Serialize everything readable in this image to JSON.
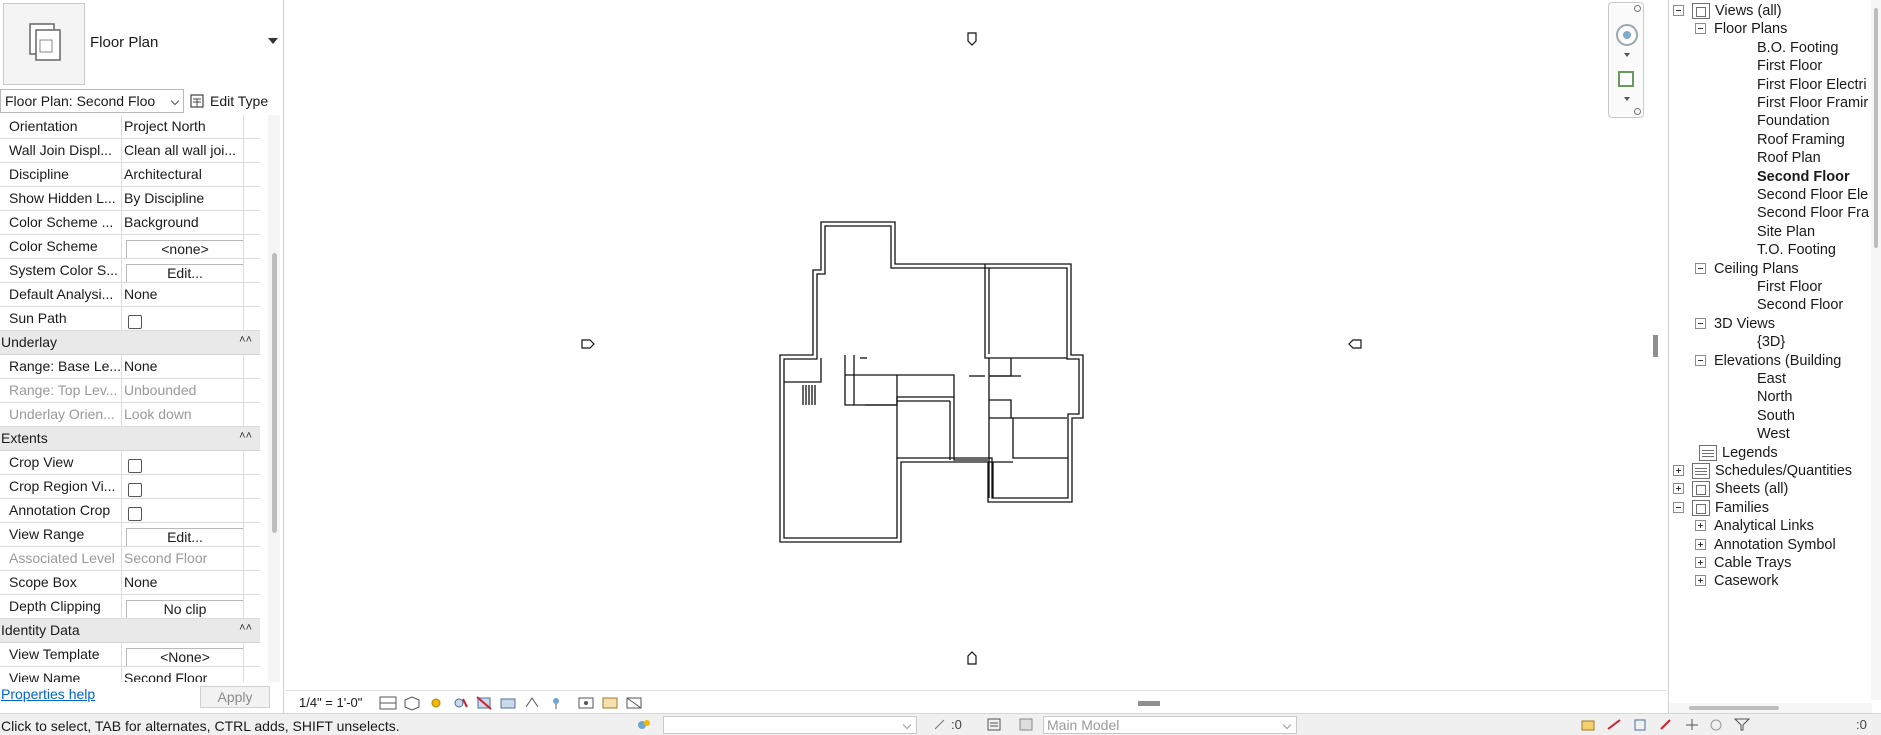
{
  "properties": {
    "type_name": "Floor Plan",
    "instance_selector": "Floor Plan: Second Floo",
    "edit_type_label": "Edit Type",
    "rows_top": [
      {
        "name": "Orientation",
        "value": "Project North",
        "kind": "text"
      },
      {
        "name": "Wall Join Displ...",
        "value": "Clean all wall joi...",
        "kind": "text"
      },
      {
        "name": "Discipline",
        "value": "Architectural",
        "kind": "text"
      },
      {
        "name": "Show Hidden L...",
        "value": "By Discipline",
        "kind": "text"
      },
      {
        "name": "Color Scheme ...",
        "value": "Background",
        "kind": "text"
      },
      {
        "name": "Color Scheme",
        "value": "<none>",
        "kind": "button"
      },
      {
        "name": "System Color S...",
        "value": "Edit...",
        "kind": "button"
      },
      {
        "name": "Default Analysi...",
        "value": "None",
        "kind": "text"
      },
      {
        "name": "Sun Path",
        "value": "",
        "kind": "checkbox"
      }
    ],
    "group_underlay": "Underlay",
    "rows_underlay": [
      {
        "name": "Range: Base Le...",
        "value": "None",
        "kind": "text"
      },
      {
        "name": "Range: Top Lev...",
        "value": "Unbounded",
        "kind": "text",
        "dim": true
      },
      {
        "name": "Underlay Orien...",
        "value": "Look down",
        "kind": "text",
        "dim": true
      }
    ],
    "group_extents": "Extents",
    "rows_extents": [
      {
        "name": "Crop View",
        "value": "",
        "kind": "checkbox"
      },
      {
        "name": "Crop Region Vi...",
        "value": "",
        "kind": "checkbox"
      },
      {
        "name": "Annotation Crop",
        "value": "",
        "kind": "checkbox"
      },
      {
        "name": "View Range",
        "value": "Edit...",
        "kind": "button"
      },
      {
        "name": "Associated Level",
        "value": "Second Floor",
        "kind": "text",
        "dim": true
      },
      {
        "name": "Scope Box",
        "value": "None",
        "kind": "text"
      },
      {
        "name": "Depth Clipping",
        "value": "No clip",
        "kind": "button"
      }
    ],
    "group_identity": "Identity Data",
    "rows_identity": [
      {
        "name": "View Template",
        "value": "<None>",
        "kind": "button"
      },
      {
        "name": "View Name",
        "value": "Second Floor",
        "kind": "text"
      }
    ],
    "help_link": "Properties help",
    "apply_label": "Apply"
  },
  "view": {
    "scale": "1/4\" = 1'-0\""
  },
  "browser": {
    "root": "Views (all)",
    "floor_plans_label": "Floor Plans",
    "floor_plans": [
      "B.O. Footing",
      "First Floor",
      "First Floor Electri",
      "First Floor Framir",
      "Foundation",
      "Roof Framing",
      "Roof Plan",
      "Second Floor",
      "Second Floor Ele",
      "Second Floor Fra",
      "Site Plan",
      "T.O. Footing"
    ],
    "active_view": "Second Floor",
    "ceiling_plans_label": "Ceiling Plans",
    "ceiling_plans": [
      "First Floor",
      "Second Floor"
    ],
    "views_3d_label": "3D Views",
    "views_3d": [
      "{3D}"
    ],
    "elevations_label": "Elevations (Building",
    "elevations": [
      "East",
      "North",
      "South",
      "West"
    ],
    "legends": "Legends",
    "schedules": "Schedules/Quantities",
    "sheets": "Sheets (all)",
    "families": "Families",
    "family_items": [
      "Analytical Links",
      "Annotation Symbol",
      "Cable Trays",
      "Casework"
    ]
  },
  "status": {
    "hint": "Click to select, TAB for alternates, CTRL adds, SHIFT unselects.",
    "model": "Main Model",
    "count_a": ":0",
    "count_b": ":0"
  }
}
